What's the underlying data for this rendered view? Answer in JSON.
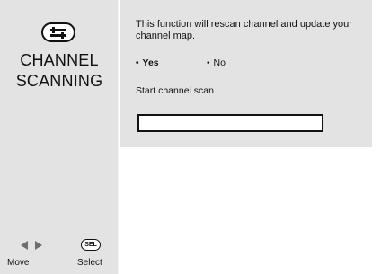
{
  "sidebar": {
    "icon": "setup-tools-icon",
    "title_line1": "CHANNEL",
    "title_line2": "SCANNING"
  },
  "hints": {
    "move_label": "Move",
    "select_label": "Select",
    "sel_badge": "SEL",
    "move_icon": "left-right-arrows-icon"
  },
  "panel": {
    "description": "This function will rescan channel and update your channel map.",
    "option_yes": "Yes",
    "option_no": "No",
    "bullet": "•",
    "scan_label": "Start channel scan",
    "scan_progress": 0
  }
}
